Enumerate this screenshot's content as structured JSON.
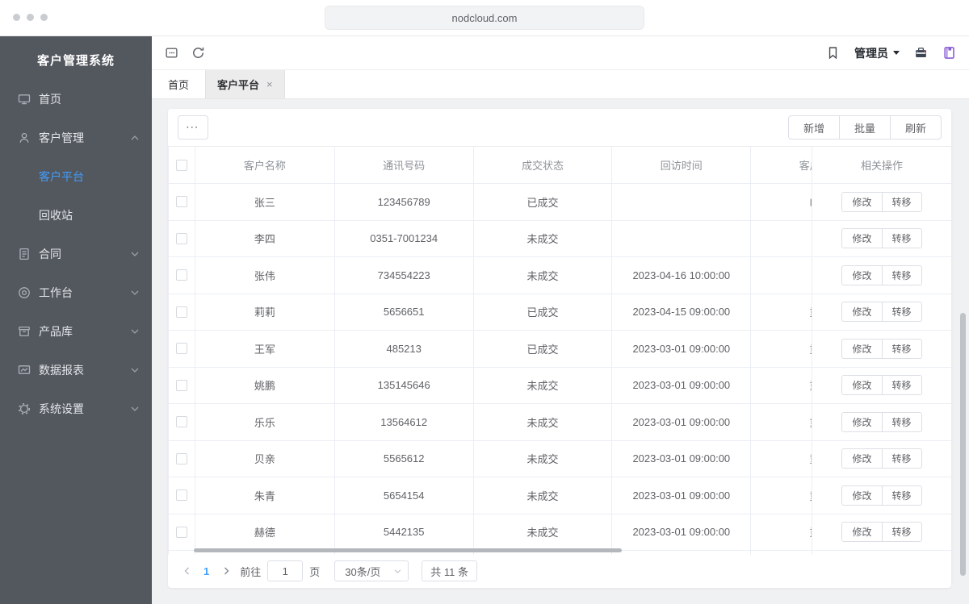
{
  "browser": {
    "url": "nodcloud.com"
  },
  "topbar": {
    "user_menu_label": "管理员"
  },
  "sidebar": {
    "title": "客户管理系统",
    "items": [
      {
        "label": "首页",
        "icon": "monitor"
      },
      {
        "label": "客户管理",
        "icon": "user",
        "expanded": true,
        "children": [
          {
            "label": "客户平台",
            "active": true
          },
          {
            "label": "回收站"
          }
        ]
      },
      {
        "label": "合同",
        "icon": "document"
      },
      {
        "label": "工作台",
        "icon": "target"
      },
      {
        "label": "产品库",
        "icon": "archive-box"
      },
      {
        "label": "数据报表",
        "icon": "chart-board"
      },
      {
        "label": "系统设置",
        "icon": "gear"
      }
    ]
  },
  "tabs": [
    {
      "label": "首页"
    },
    {
      "label": "客户平台",
      "active": true,
      "close": "×"
    }
  ],
  "card": {
    "more_button": "···",
    "action_buttons": [
      "新增",
      "批量",
      "刷新"
    ]
  },
  "table": {
    "headers": {
      "name": "客户名称",
      "phone": "通讯号码",
      "deal_status": "成交状态",
      "visit_time": "回访时间",
      "level": "客户级别",
      "operations": "相关操作"
    },
    "rows": [
      {
        "name": "张三",
        "phone": "123456789",
        "deal_status": "已成交",
        "visit_time": "",
        "level": "临时"
      },
      {
        "name": "李四",
        "phone": "0351-7001234",
        "deal_status": "未成交",
        "visit_time": "",
        "level": ""
      },
      {
        "name": "张伟",
        "phone": "734554223",
        "deal_status": "未成交",
        "visit_time": "2023-04-16 10:00:00",
        "level": ""
      },
      {
        "name": "莉莉",
        "phone": "5656651",
        "deal_status": "已成交",
        "visit_time": "2023-04-15 09:00:00",
        "level": "重要"
      },
      {
        "name": "王军",
        "phone": "485213",
        "deal_status": "已成交",
        "visit_time": "2023-03-01 09:00:00",
        "level": "重要"
      },
      {
        "name": "姚鹏",
        "phone": "135145646",
        "deal_status": "未成交",
        "visit_time": "2023-03-01 09:00:00",
        "level": "重要"
      },
      {
        "name": "乐乐",
        "phone": "13564612",
        "deal_status": "未成交",
        "visit_time": "2023-03-01 09:00:00",
        "level": "重要"
      },
      {
        "name": "贝亲",
        "phone": "5565612",
        "deal_status": "未成交",
        "visit_time": "2023-03-01 09:00:00",
        "level": "重要"
      },
      {
        "name": "朱青",
        "phone": "5654154",
        "deal_status": "未成交",
        "visit_time": "2023-03-01 09:00:00",
        "level": "重要"
      },
      {
        "name": "赫德",
        "phone": "5442135",
        "deal_status": "未成交",
        "visit_time": "2023-03-01 09:00:00",
        "level": "重要"
      }
    ],
    "row_actions": [
      "修改",
      "转移"
    ]
  },
  "pagination": {
    "current_page": "1",
    "goto_label": "前往",
    "goto_value": "1",
    "page_unit": "页",
    "page_size": "30条/页",
    "total": "共 11 条"
  },
  "icons": {
    "toolbar_left": [
      "collapse-menu",
      "refresh"
    ],
    "toolbar_right": [
      "bookmark",
      "caret-down",
      "toolbox",
      "notebook"
    ],
    "sidebar": [
      "monitor",
      "user",
      "document",
      "target",
      "archive-box",
      "chart-board",
      "gear"
    ]
  },
  "colors": {
    "accent": "#409eff",
    "sidebar_bg": "#53575e",
    "table_border": "#ebeef5"
  }
}
